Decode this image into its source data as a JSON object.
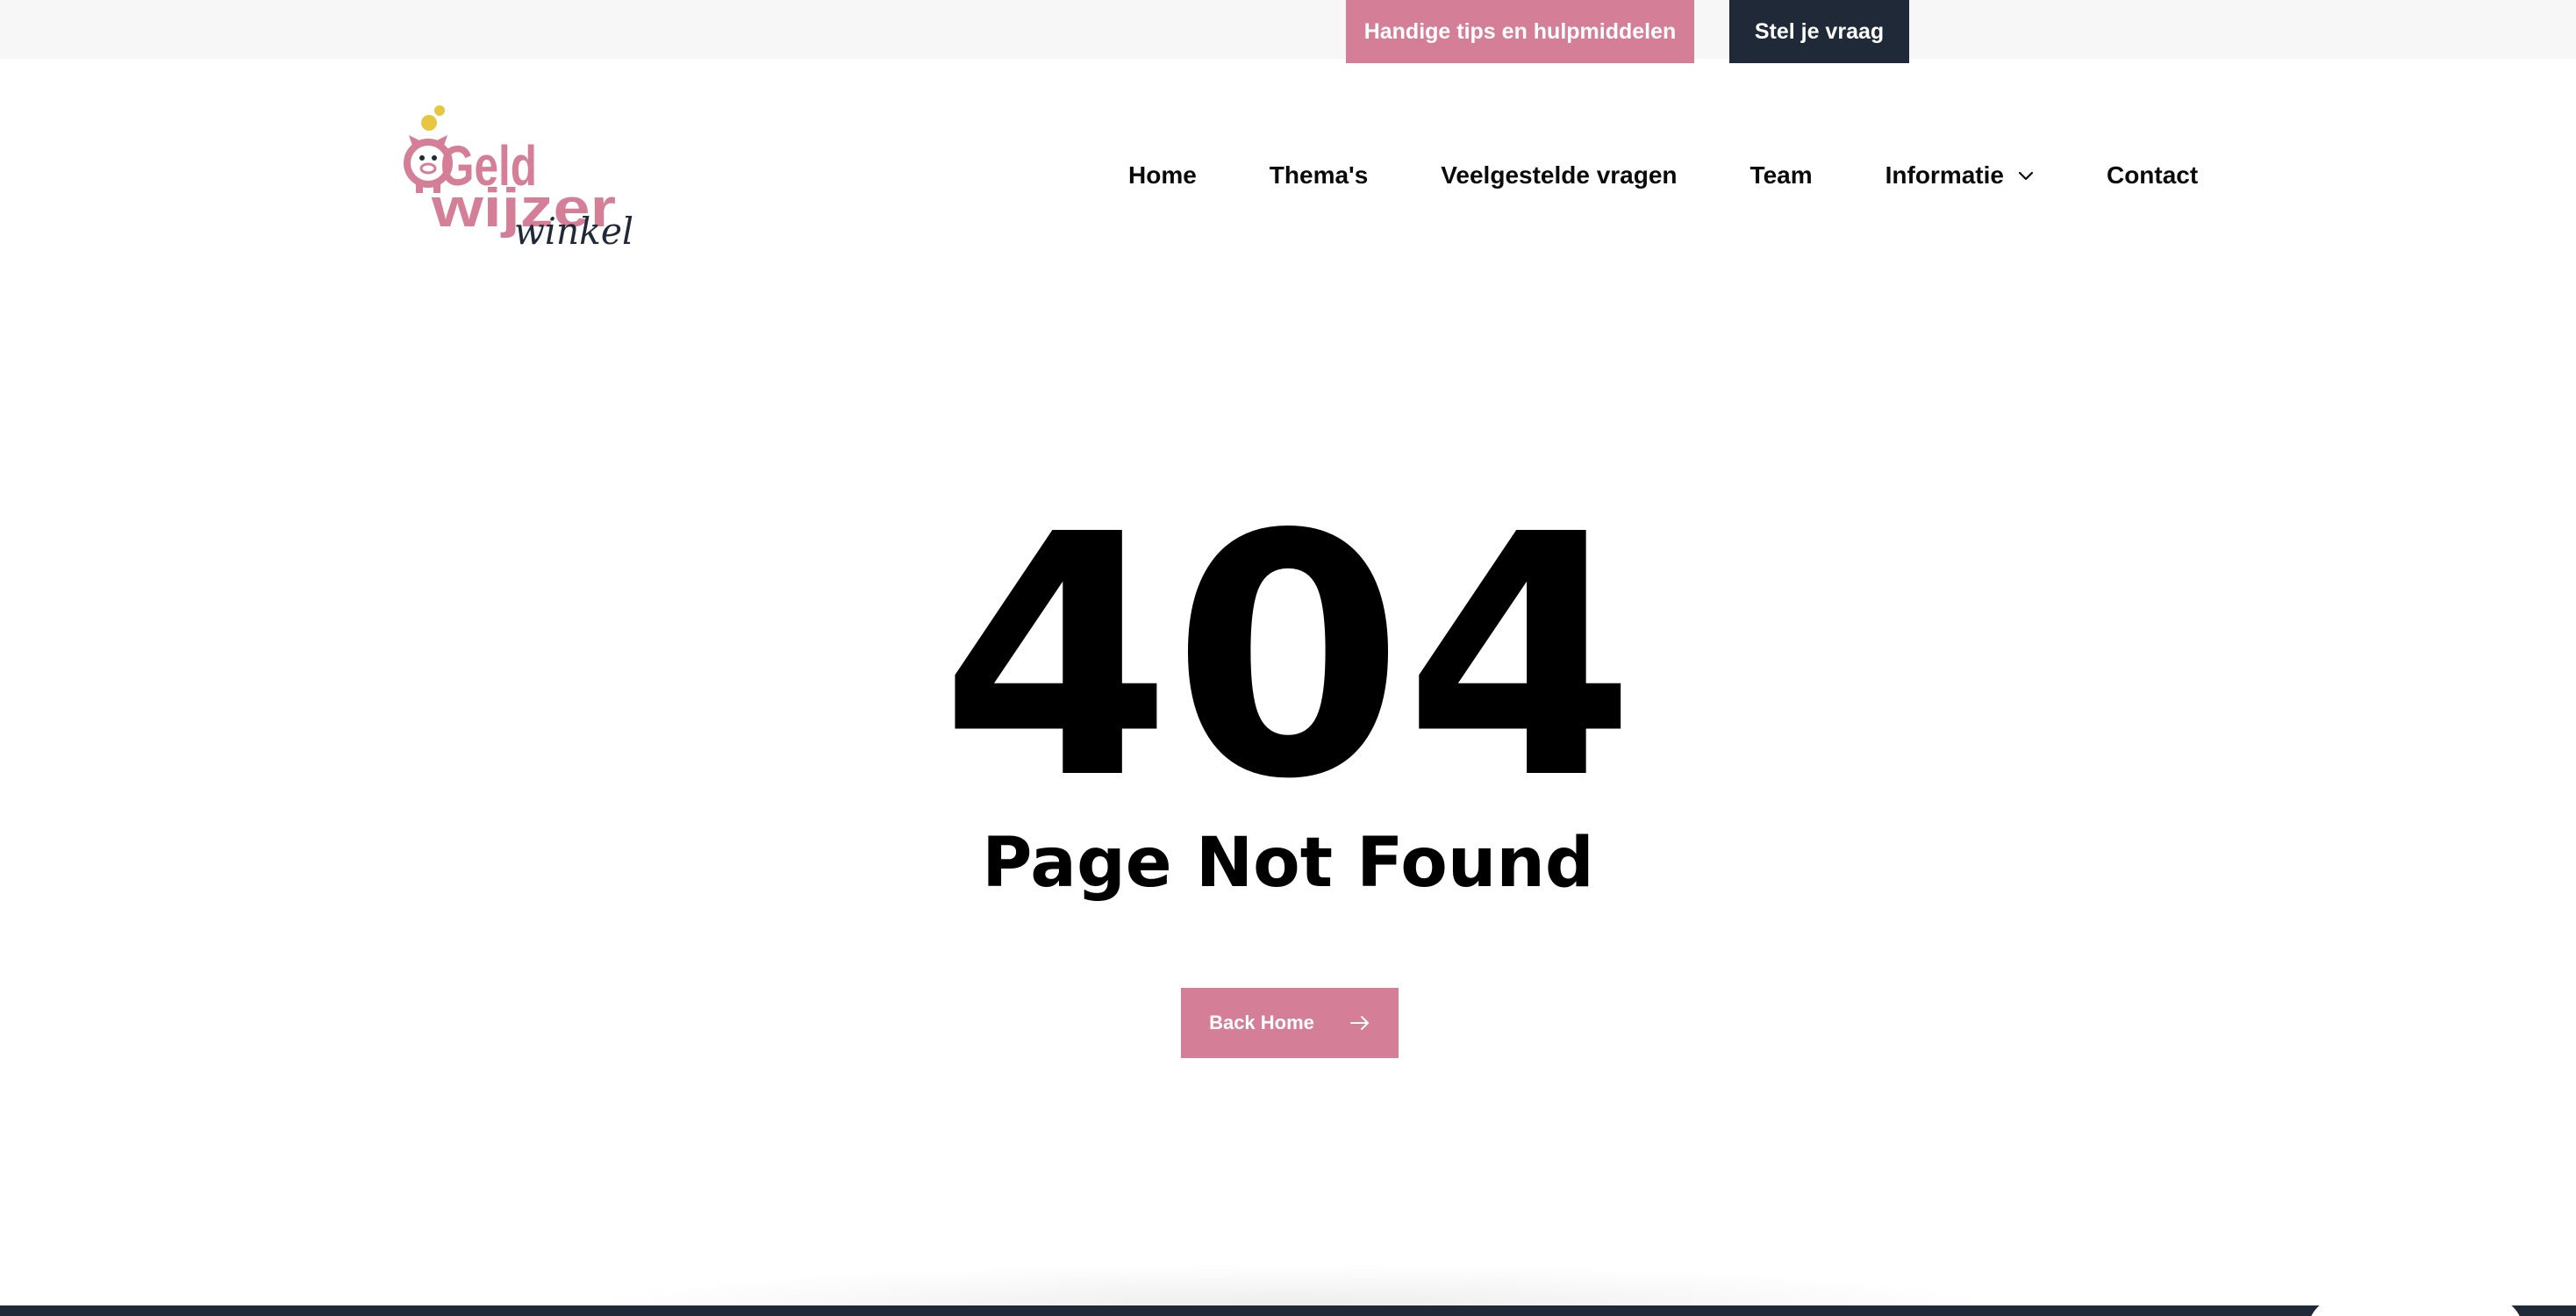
{
  "colors": {
    "pink": "#d47e97",
    "navy": "#1f2937",
    "topbar_bg": "#f7f7f7",
    "footer_bg": "#1f2937",
    "coin": "#e8c640",
    "logo_text_dark": "#1f2937"
  },
  "topbar": {
    "tips_label": "Handige tips en hulpmiddelen",
    "ask_label": "Stel je vraag"
  },
  "logo": {
    "line1": "Geld",
    "line2": "wijzer",
    "line3": "winkel",
    "icon": "piggy-bank-icon"
  },
  "nav": {
    "items": [
      {
        "label": "Home"
      },
      {
        "label": "Thema's"
      },
      {
        "label": "Veelgestelde vragen"
      },
      {
        "label": "Team"
      },
      {
        "label": "Informatie",
        "icon": "chevron-down-icon"
      },
      {
        "label": "Contact"
      }
    ]
  },
  "error": {
    "code": "404",
    "title": "Page Not Found",
    "back_label": "Back Home",
    "back_icon": "arrow-right-icon"
  }
}
